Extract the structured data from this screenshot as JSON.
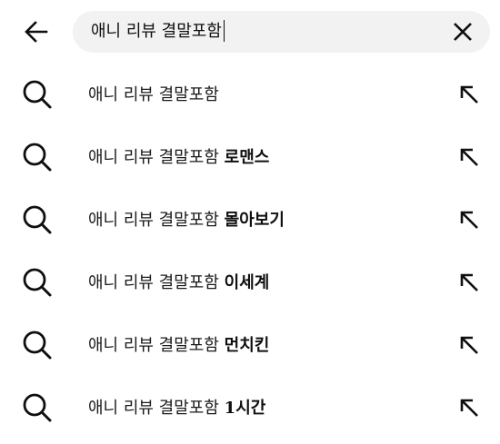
{
  "search": {
    "value": "애니 리뷰 결말포함",
    "back_icon": "arrow-left-icon",
    "clear_icon": "close-icon"
  },
  "suggestions": [
    {
      "prefix": "애니 리뷰 결말포함",
      "suffix": "",
      "icon": "search-icon",
      "action_icon": "arrow-up-left-icon"
    },
    {
      "prefix": "애니 리뷰 결말포함",
      "suffix": "로맨스",
      "icon": "search-icon",
      "action_icon": "arrow-up-left-icon"
    },
    {
      "prefix": "애니 리뷰 결말포함",
      "suffix": "몰아보기",
      "icon": "search-icon",
      "action_icon": "arrow-up-left-icon"
    },
    {
      "prefix": "애니 리뷰 결말포함",
      "suffix": "이세계",
      "icon": "search-icon",
      "action_icon": "arrow-up-left-icon"
    },
    {
      "prefix": "애니 리뷰 결말포함",
      "suffix": "먼치킨",
      "icon": "search-icon",
      "action_icon": "arrow-up-left-icon"
    },
    {
      "prefix": "애니 리뷰 결말포함",
      "suffix": "1시간",
      "icon": "search-icon",
      "action_icon": "arrow-up-left-icon"
    }
  ]
}
